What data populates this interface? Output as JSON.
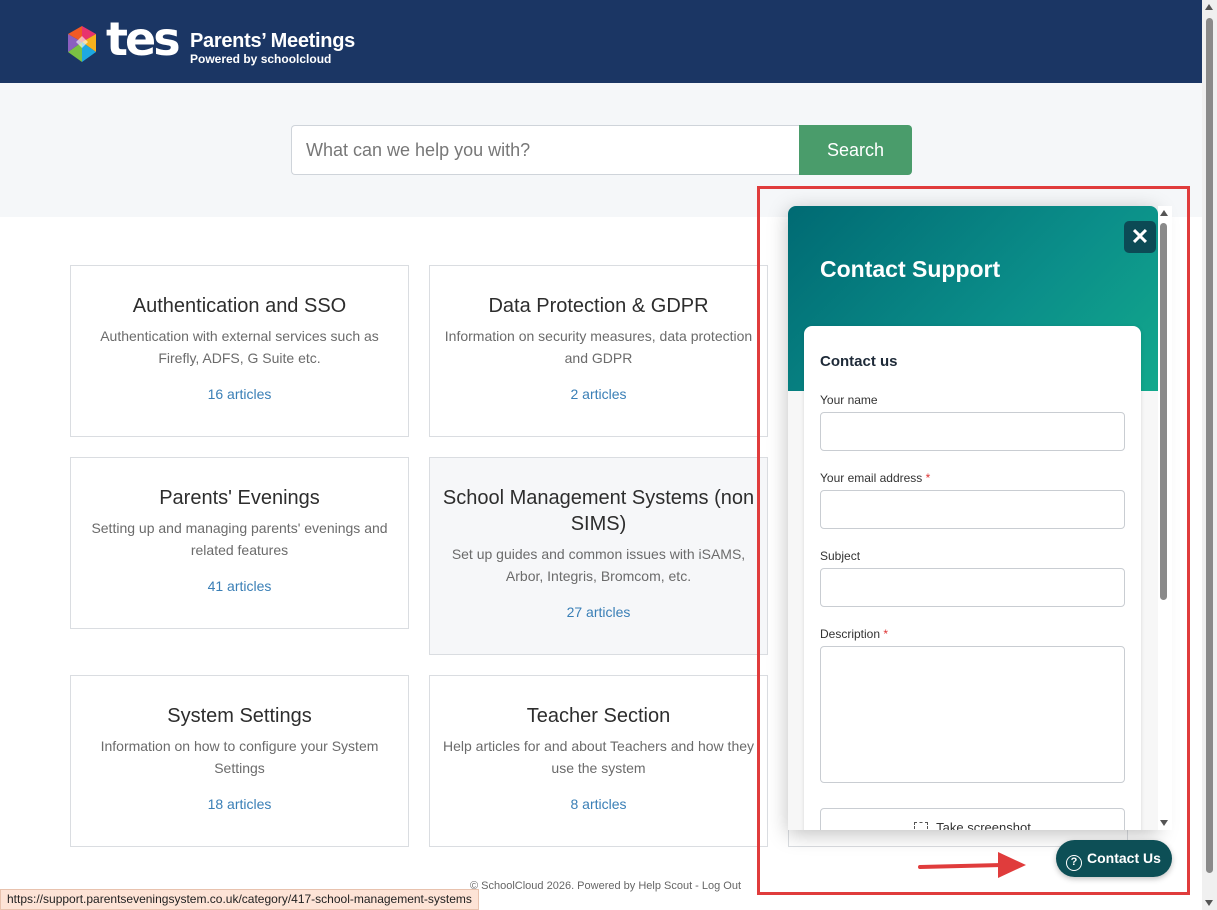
{
  "header": {
    "logo_text": "tes",
    "brand_title": "Parents’ Meetings",
    "brand_sub": "Powered by schoolcloud"
  },
  "search": {
    "placeholder": "What can we help you with?",
    "button_label": "Search"
  },
  "categories": [
    {
      "title": "Authentication and SSO",
      "desc": "Authentication with external services such as Firefly, ADFS, G Suite etc.",
      "count": "16 articles"
    },
    {
      "title": "Data Protection & GDPR",
      "desc": "Information on security measures, data protection and GDPR",
      "count": "2 articles"
    },
    {
      "title": "Parents' Evenings",
      "desc": "Setting up and managing parents' evenings and related features",
      "count": "41 articles"
    },
    {
      "title": "School Management Systems (non SIMS)",
      "desc": "Set up guides and common issues with iSAMS, Arbor, Integris, Bromcom, etc.",
      "count": "27 articles"
    },
    {
      "title": "System Settings",
      "desc": "Information on how to configure your System Settings",
      "count": "18 articles"
    },
    {
      "title": "Teacher Section",
      "desc": "Help articles for and about Teachers and how they use the system",
      "count": "8 articles"
    }
  ],
  "footer": {
    "text": "© SchoolCloud 2026. Powered by Help Scout - Log Out"
  },
  "status_bar": {
    "url": "https://support.parentseveningsystem.co.uk/category/417-school-management-systems"
  },
  "widget": {
    "title": "Contact Support",
    "close_label": "✕",
    "form_heading": "Contact us",
    "name_label": "Your name",
    "email_label": "Your email address",
    "subject_label": "Subject",
    "description_label": "Description",
    "required_mark": "*",
    "screenshot_label": "Take screenshot"
  },
  "contact_button": {
    "label": "Contact Us",
    "icon": "?"
  },
  "colors": {
    "header_bg": "#1b3664",
    "search_button": "#4a9c6b",
    "link": "#3a7fb6",
    "widget_gradient_start": "#006a73",
    "widget_gradient_end": "#12a98c",
    "contact_button": "#0d4f56",
    "highlight": "#e03c3c"
  }
}
